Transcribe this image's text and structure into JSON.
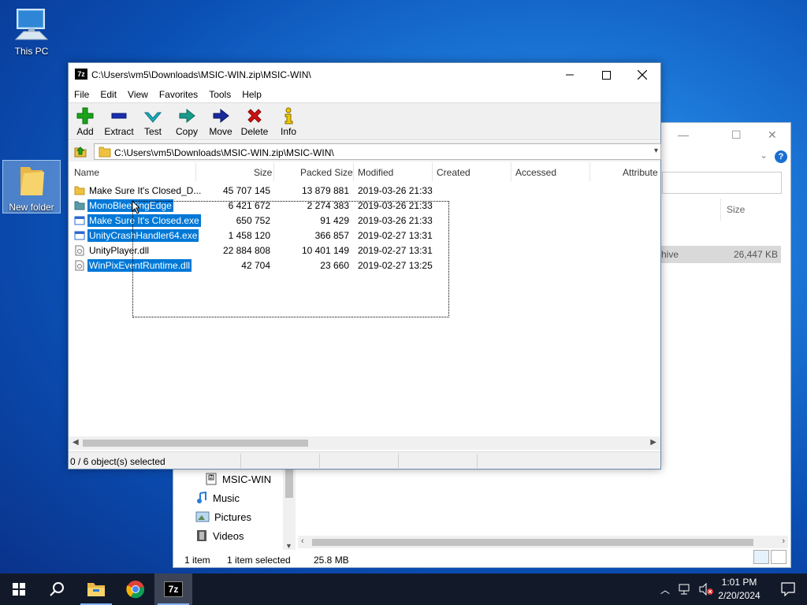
{
  "desktop": {
    "icons": [
      {
        "label": "This PC"
      },
      {
        "label": "New folder"
      }
    ]
  },
  "explorer": {
    "column_size": "Size",
    "selected_row": {
      "name": "hive",
      "size": "26,447 KB"
    },
    "help": "?",
    "nav_items": [
      {
        "label": "MSIC-WIN"
      },
      {
        "label": "Music"
      },
      {
        "label": "Pictures"
      },
      {
        "label": "Videos"
      }
    ],
    "status": {
      "count": "1 item",
      "selected": "1 item selected",
      "size": "25.8 MB"
    }
  },
  "sevenzip": {
    "title": "C:\\Users\\vm5\\Downloads\\MSIC-WIN.zip\\MSIC-WIN\\",
    "app_icon": "7z",
    "menu": [
      "File",
      "Edit",
      "View",
      "Favorites",
      "Tools",
      "Help"
    ],
    "toolbar": [
      {
        "label": "Add",
        "icon": "plus-icon",
        "color": "#1aa31a"
      },
      {
        "label": "Extract",
        "icon": "minus-icon",
        "color": "#1a2fb0"
      },
      {
        "label": "Test",
        "icon": "check-icon",
        "color": "#1aa0b0"
      },
      {
        "label": "Copy",
        "icon": "copy-arrow-icon",
        "color": "#1a9a8a"
      },
      {
        "label": "Move",
        "icon": "move-arrow-icon",
        "color": "#1a2a9a"
      },
      {
        "label": "Delete",
        "icon": "x-icon",
        "color": "#d01010"
      },
      {
        "label": "Info",
        "icon": "info-icon",
        "color": "#c8a000"
      }
    ],
    "address": "C:\\Users\\vm5\\Downloads\\MSIC-WIN.zip\\MSIC-WIN\\",
    "columns": [
      "Name",
      "Size",
      "Packed Size",
      "Modified",
      "Created",
      "Accessed",
      "Attribute"
    ],
    "files": [
      {
        "name": "Make Sure It's Closed_D...",
        "size": "45 707 145",
        "packed": "13 879 881",
        "modified": "2019-03-26 21:33",
        "type": "folder",
        "selected": false
      },
      {
        "name": "MonoBleedingEdge",
        "size": "6 421 672",
        "packed": "2 274 383",
        "modified": "2019-03-26 21:33",
        "type": "folder",
        "selected": true
      },
      {
        "name": "Make Sure It's Closed.exe",
        "size": "650 752",
        "packed": "91 429",
        "modified": "2019-03-26 21:33",
        "type": "exe",
        "selected": true
      },
      {
        "name": "UnityCrashHandler64.exe",
        "size": "1 458 120",
        "packed": "366 857",
        "modified": "2019-02-27 13:31",
        "type": "exe",
        "selected": true
      },
      {
        "name": "UnityPlayer.dll",
        "size": "22 884 808",
        "packed": "10 401 149",
        "modified": "2019-02-27 13:31",
        "type": "dll",
        "selected": false
      },
      {
        "name": "WinPixEventRuntime.dll",
        "size": "42 704",
        "packed": "23 660",
        "modified": "2019-02-27 13:25",
        "type": "dll",
        "selected": true
      }
    ],
    "status": "0 / 6 object(s) selected"
  },
  "taskbar": {
    "time": "1:01 PM",
    "date": "2/20/2024",
    "pinned_7z": "7z"
  },
  "colors": {
    "selection": "#0078d7",
    "taskbar": "#121a2a"
  }
}
